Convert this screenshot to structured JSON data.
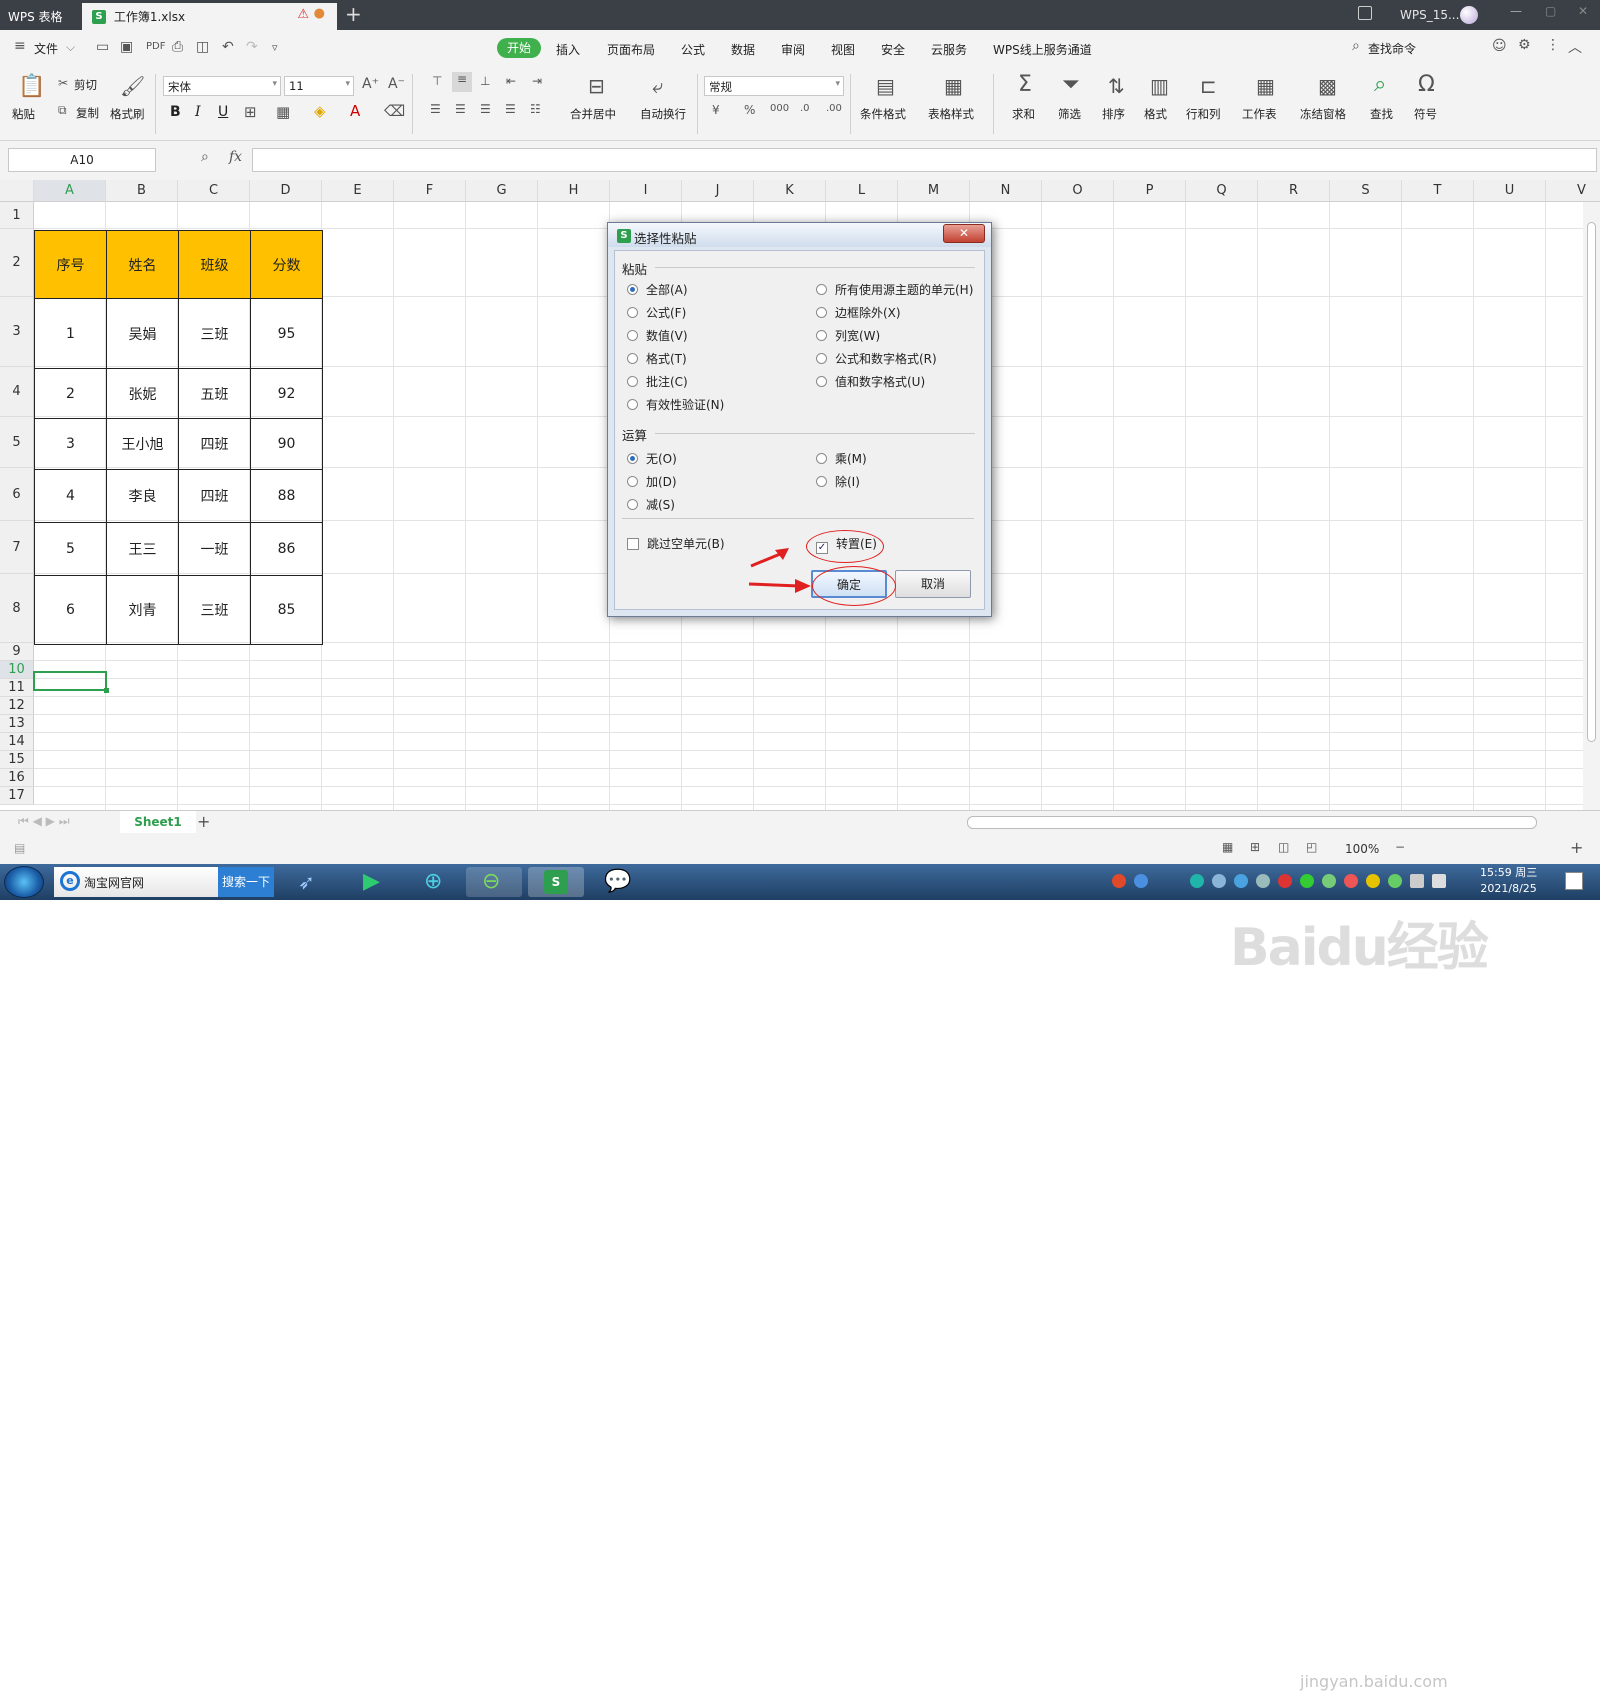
{
  "titlebar": {
    "app_name": "WPS 表格",
    "doc_name": "工作簿1.xlsx",
    "add_tab": "+",
    "user": "WPS_15...",
    "minimize": "—",
    "maximize": "▢",
    "close": "✕"
  },
  "menubar": {
    "file": "文件",
    "tabs": [
      "开始",
      "插入",
      "页面布局",
      "公式",
      "数据",
      "审阅",
      "视图",
      "安全",
      "云服务",
      "WPS线上服务通道"
    ],
    "search_command": "查找命令"
  },
  "ribbon": {
    "paste": "粘贴",
    "cut": "剪切",
    "copy": "复制",
    "format_painter": "格式刷",
    "font_name": "宋体",
    "font_size": "11",
    "bold": "B",
    "italic": "I",
    "underline": "U",
    "merge_center": "合并居中",
    "wrap_text": "自动换行",
    "number_format": "常规",
    "conditional_format": "条件格式",
    "table_style": "表格样式",
    "sum": "求和",
    "filter": "筛选",
    "sort": "排序",
    "format": "格式",
    "row_col": "行和列",
    "worksheet": "工作表",
    "freeze": "冻结窗格",
    "find": "查找",
    "symbol": "符号"
  },
  "formula_bar": {
    "cell_ref": "A10",
    "fx": "fx",
    "value": ""
  },
  "columns": [
    "A",
    "B",
    "C",
    "D",
    "E",
    "F",
    "G",
    "H",
    "I",
    "J",
    "K",
    "L",
    "M",
    "N",
    "O",
    "P",
    "Q",
    "R",
    "S",
    "T",
    "U",
    "V"
  ],
  "rows": [
    "1",
    "2",
    "3",
    "4",
    "5",
    "6",
    "7",
    "8",
    "9",
    "10",
    "11",
    "12",
    "13",
    "14",
    "15",
    "16",
    "17"
  ],
  "table": {
    "headers": [
      "序号",
      "姓名",
      "班级",
      "分数"
    ],
    "rows": [
      [
        "1",
        "吴娟",
        "三班",
        "95"
      ],
      [
        "2",
        "张妮",
        "五班",
        "92"
      ],
      [
        "3",
        "王小旭",
        "四班",
        "90"
      ],
      [
        "4",
        "李良",
        "四班",
        "88"
      ],
      [
        "5",
        "王三",
        "一班",
        "86"
      ],
      [
        "6",
        "刘青",
        "三班",
        "85"
      ]
    ]
  },
  "dialog": {
    "title": "选择性粘贴",
    "close": "✕",
    "paste_section": "粘贴",
    "paste_options_left": [
      "全部(A)",
      "公式(F)",
      "数值(V)",
      "格式(T)",
      "批注(C)",
      "有效性验证(N)"
    ],
    "paste_options_right": [
      "所有使用源主题的单元(H)",
      "边框除外(X)",
      "列宽(W)",
      "公式和数字格式(R)",
      "值和数字格式(U)"
    ],
    "operation_section": "运算",
    "operation_left": [
      "无(O)",
      "加(D)",
      "减(S)"
    ],
    "operation_right": [
      "乘(M)",
      "除(I)"
    ],
    "skip_blanks": "跳过空单元(B)",
    "transpose": "转置(E)",
    "ok": "确定",
    "cancel": "取消",
    "selected_paste": "全部(A)",
    "selected_operation": "无(O)",
    "transpose_checked": true,
    "skip_blanks_checked": false
  },
  "sheet_tabs": {
    "active": "Sheet1",
    "add": "+"
  },
  "status": {
    "zoom": "100%"
  },
  "taskbar": {
    "ie_label": "淘宝网官网",
    "search": "搜索一下",
    "time": "15:59 周三",
    "date": "2021/8/25"
  },
  "watermark": {
    "brand": "Baidu经验",
    "url": "jingyan.baidu.com"
  },
  "colors": {
    "header_fill": "#ffc000",
    "accent_green": "#3fb04c",
    "annotation_red": "#e02020"
  }
}
